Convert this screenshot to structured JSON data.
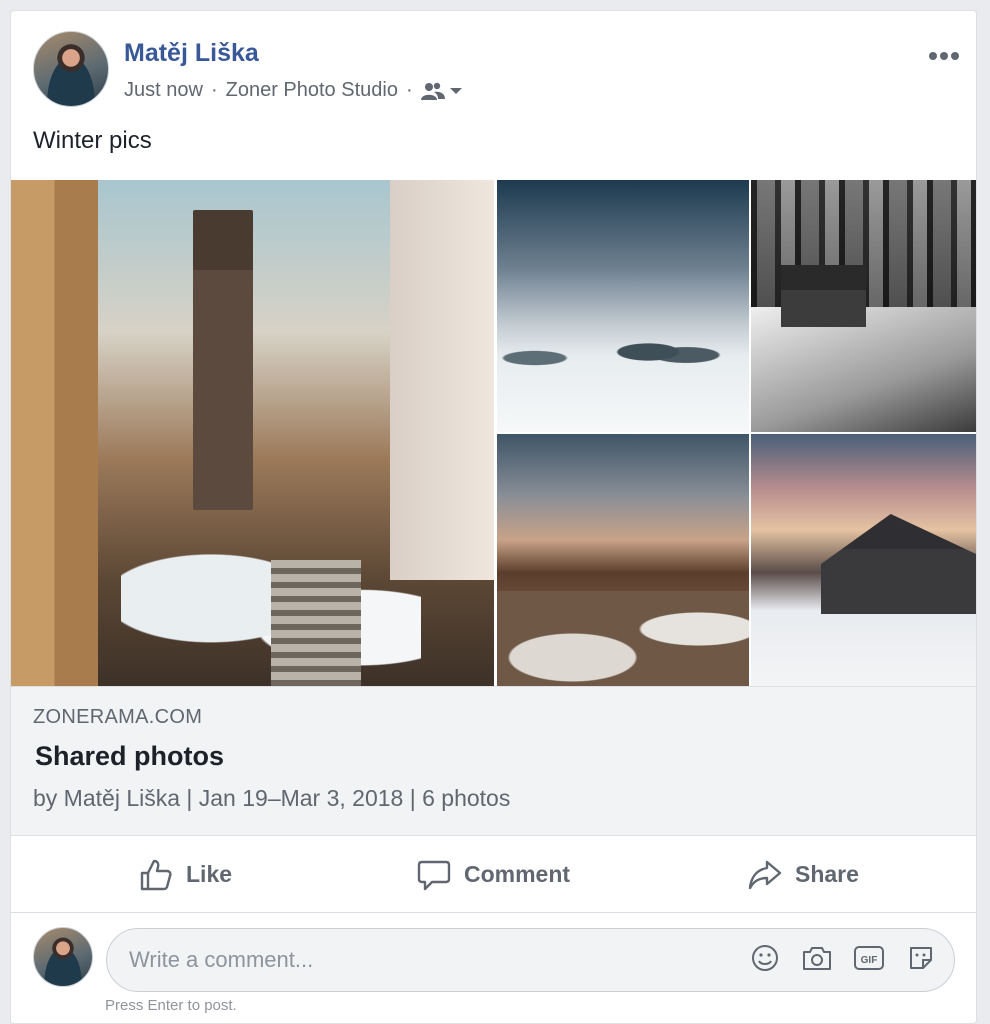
{
  "post": {
    "author": "Matěj Liška",
    "time": "Just now",
    "separator": "·",
    "app": "Zoner Photo Studio",
    "text": "Winter pics",
    "more_icon": "more-horizontal-icon",
    "audience_icon": "friends-icon"
  },
  "link": {
    "domain": "ZONERAMA.COM",
    "title": "Shared photos",
    "description": "by Matěj Liška | Jan 19–Mar 3, 2018 | 6 photos"
  },
  "actions": {
    "like": "Like",
    "comment": "Comment",
    "share": "Share"
  },
  "comment_box": {
    "placeholder": "Write a comment...",
    "hint": "Press Enter to post.",
    "icons": [
      "emoji-icon",
      "camera-icon",
      "gif-icon",
      "sticker-icon"
    ]
  },
  "colors": {
    "link_blue": "#385898",
    "secondary_text": "#606770",
    "background": "#e9ebee"
  }
}
